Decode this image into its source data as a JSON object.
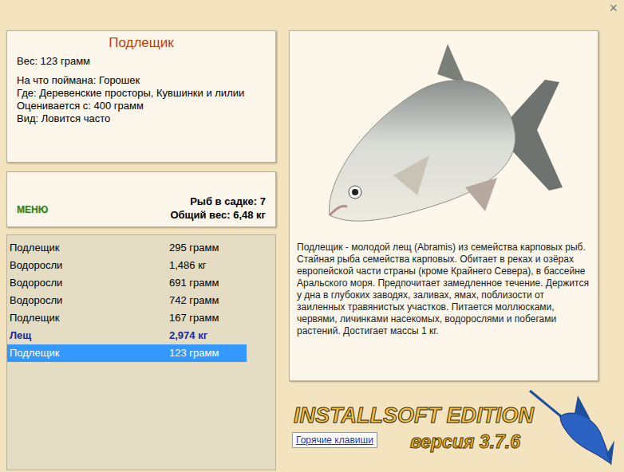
{
  "window": {
    "close": "×"
  },
  "fish_card": {
    "title": "Подлещик",
    "lines": [
      "Вес: 123 грамм",
      "На что поймана: Горошек",
      "Где: Деревенские просторы, Кувшинки и лилии",
      "Оценивается с: 400 грамм",
      "Вид: Ловится часто"
    ]
  },
  "menu_button": "МЕНЮ",
  "keepnet": {
    "count": "Рыб в садке: 7",
    "total": "Общий вес: 6,48 кг"
  },
  "catch_list": [
    {
      "name": "Подлещик",
      "weight": "295 грамм",
      "highlighted": false,
      "selected": false
    },
    {
      "name": "Водоросли",
      "weight": "1,486 кг",
      "highlighted": false,
      "selected": false
    },
    {
      "name": "Водоросли",
      "weight": "691 грамм",
      "highlighted": false,
      "selected": false
    },
    {
      "name": "Водоросли",
      "weight": "742 грамм",
      "highlighted": false,
      "selected": false
    },
    {
      "name": "Подлещик",
      "weight": "167 грамм",
      "highlighted": false,
      "selected": false
    },
    {
      "name": "Лещ",
      "weight": "2,974 кг",
      "highlighted": true,
      "selected": false
    },
    {
      "name": "Подлещик",
      "weight": "123 грамм",
      "highlighted": false,
      "selected": true
    }
  ],
  "description": "Подлещик - молодой лещ (Abramis) из семейства карповых рыб. Стайная рыба семейства карповых. Обитает в реках и озёрах европейской части страны (кроме Крайнего Севера), в бассейне Аральского моря. Предпочитает замедленное течение. Держится у дна в глубоких заводях, заливах, ямах, поблизости от заиленных травянистых участков. Питается моллюсками, червями, личинками насекомых, водорослями и побегами растений. Достигает массы 1 кг.",
  "logo": {
    "title": "INSTALLSOFT EDITION",
    "version": "версия 3.7.6"
  },
  "hotkeys_button": "Горячие клавиши"
}
